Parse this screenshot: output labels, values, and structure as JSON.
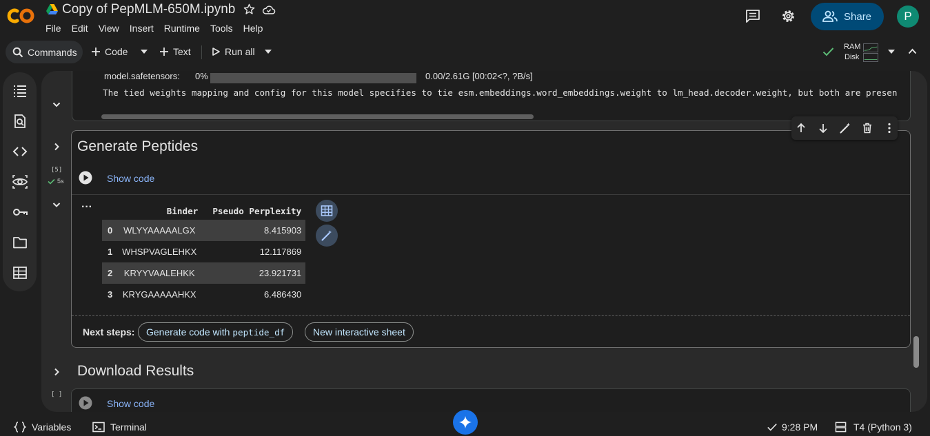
{
  "header": {
    "title": "Copy of PepMLM-650M.ipynb",
    "menu": [
      "File",
      "Edit",
      "View",
      "Insert",
      "Runtime",
      "Tools",
      "Help"
    ],
    "share_label": "Share",
    "avatar_initial": "P"
  },
  "toolbar": {
    "commands_label": "Commands",
    "code_label": "Code",
    "text_label": "Text",
    "run_all_label": "Run all",
    "ram_label": "RAM",
    "disk_label": "Disk"
  },
  "prev_output": {
    "progress_label": "model.safetensors:",
    "progress_percent": "0%",
    "progress_value": 0,
    "progress_stats": "0.00/2.61G [00:02<?, ?B/s]",
    "warning": "The tied weights mapping and config for this model specifies to tie esm.embeddings.word_embeddings.weight to lm_head.decoder.weight, but both are presen"
  },
  "generate_cell": {
    "title": "Generate Peptides",
    "exec_count": "[5]",
    "exec_time": "5s",
    "show_code": "Show code",
    "table": {
      "columns": [
        "",
        "Binder",
        "Pseudo Perplexity"
      ],
      "rows": [
        {
          "idx": "0",
          "binder": "WLYYAAAAALGX",
          "perplexity": "8.415903"
        },
        {
          "idx": "1",
          "binder": "WHSPVAGLEHKX",
          "perplexity": "12.117869"
        },
        {
          "idx": "2",
          "binder": "KRYYVAALEHKK",
          "perplexity": "23.921731"
        },
        {
          "idx": "3",
          "binder": "KRYGAAAAAHKX",
          "perplexity": "6.486430"
        }
      ]
    },
    "next_steps_label": "Next steps:",
    "chip_generate_prefix": "Generate code with",
    "chip_generate_var": "peptide_df",
    "chip_sheet": "New interactive sheet"
  },
  "download_cell": {
    "title": "Download Results",
    "exec_count": "[ ]",
    "show_code": "Show code"
  },
  "statusbar": {
    "variables": "Variables",
    "terminal": "Terminal",
    "time": "9:28 PM",
    "runtime": "T4 (Python 3)"
  },
  "colors": {
    "accent_blue": "#8ab4f8",
    "share_bg": "#004a77",
    "avatar_bg": "#0f8a73",
    "success_green": "#5bb974",
    "gemini_blue": "#1a73e8"
  }
}
